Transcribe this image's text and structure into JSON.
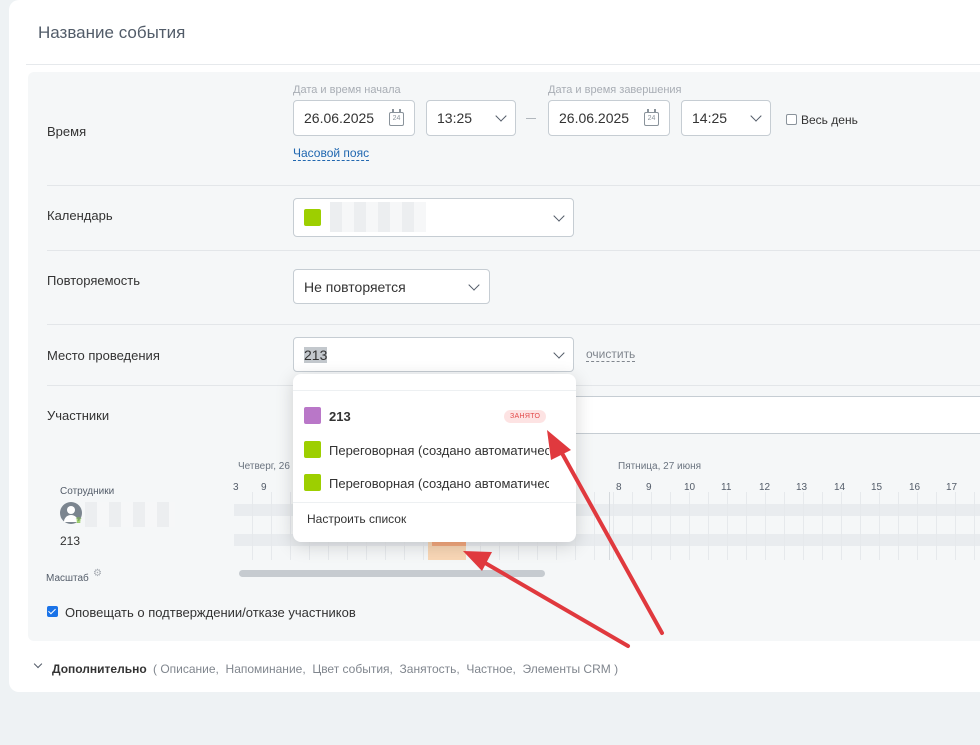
{
  "event_title": "Название события",
  "time": {
    "label": "Время",
    "start_label": "Дата и время начала",
    "end_label": "Дата и время завершения",
    "start_date": "26.06.2025",
    "start_time": "13:25",
    "end_date": "26.06.2025",
    "end_time": "14:25",
    "calendar_day": "24",
    "all_day": "Весь день",
    "timezone": "Часовой пояс"
  },
  "calendar": {
    "label": "Календарь",
    "swatch_color": "#9dcf00"
  },
  "repeat": {
    "label": "Повторяемость",
    "value": "Не повторяется"
  },
  "location": {
    "label": "Место проведения",
    "value": "213",
    "clear": "очистить",
    "dropdown": {
      "items": [
        {
          "name": "213",
          "color": "#b977c8",
          "badge": "ЗАНЯТО"
        },
        {
          "name": "Переговорная (создано автоматичес…",
          "color": "#9dcf00"
        },
        {
          "name": "Переговорная (создано автоматичес…",
          "color": "#9dcf00"
        }
      ],
      "configure": "Настроить список"
    }
  },
  "attendees": {
    "label": "Участники",
    "employees_label": "Сотрудники",
    "room": "213",
    "scale": "Масштаб",
    "day1": "Четверг, 26",
    "day2": "Пятница, 27 июня",
    "hours_day1": [
      "3",
      "9"
    ],
    "hours_day2": [
      "8",
      "9",
      "10",
      "11",
      "12",
      "13",
      "14",
      "15",
      "16",
      "17"
    ]
  },
  "notify": "Оповещать о подтверждении/отказе участников",
  "more": {
    "label": "Дополнительно",
    "items": "( Описание,  Напоминание,  Цвет события,  Занятость,  Частное,  Элементы CRM )"
  }
}
